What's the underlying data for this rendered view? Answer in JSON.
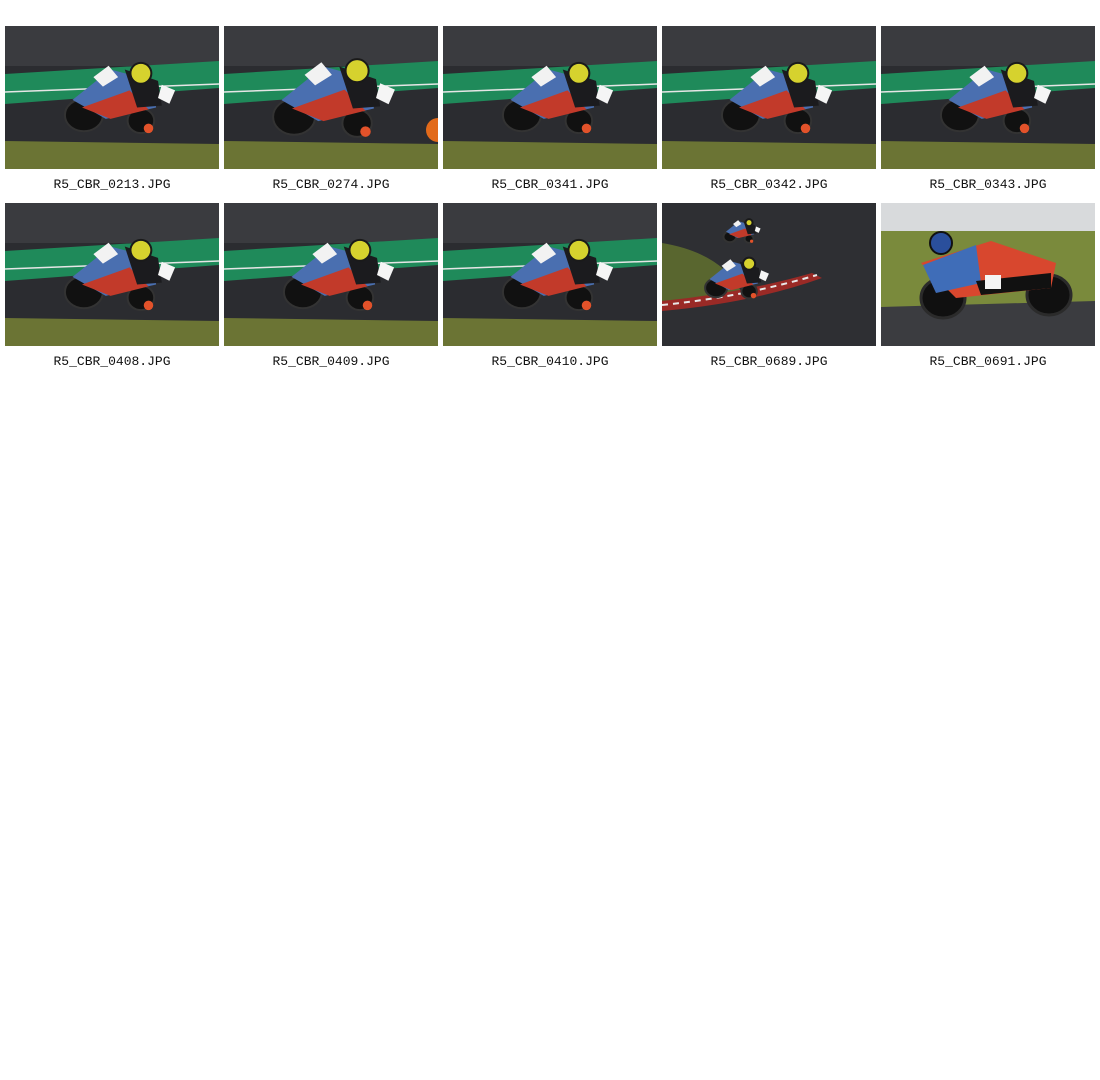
{
  "gallery": {
    "items": [
      {
        "caption": "R5_CBR_0213.JPG",
        "scene": "bike-a"
      },
      {
        "caption": "R5_CBR_0274.JPG",
        "scene": "bike-b"
      },
      {
        "caption": "R5_CBR_0341.JPG",
        "scene": "bike-a"
      },
      {
        "caption": "R5_CBR_0342.JPG",
        "scene": "bike-a"
      },
      {
        "caption": "R5_CBR_0343.JPG",
        "scene": "bike-a"
      },
      {
        "caption": "R5_CBR_0408.JPG",
        "scene": "bike-a"
      },
      {
        "caption": "R5_CBR_0409.JPG",
        "scene": "bike-a"
      },
      {
        "caption": "R5_CBR_0410.JPG",
        "scene": "bike-a"
      },
      {
        "caption": "R5_CBR_0689.JPG",
        "scene": "track-wide"
      },
      {
        "caption": "R5_CBR_0691.JPG",
        "scene": "bike-side"
      }
    ]
  }
}
